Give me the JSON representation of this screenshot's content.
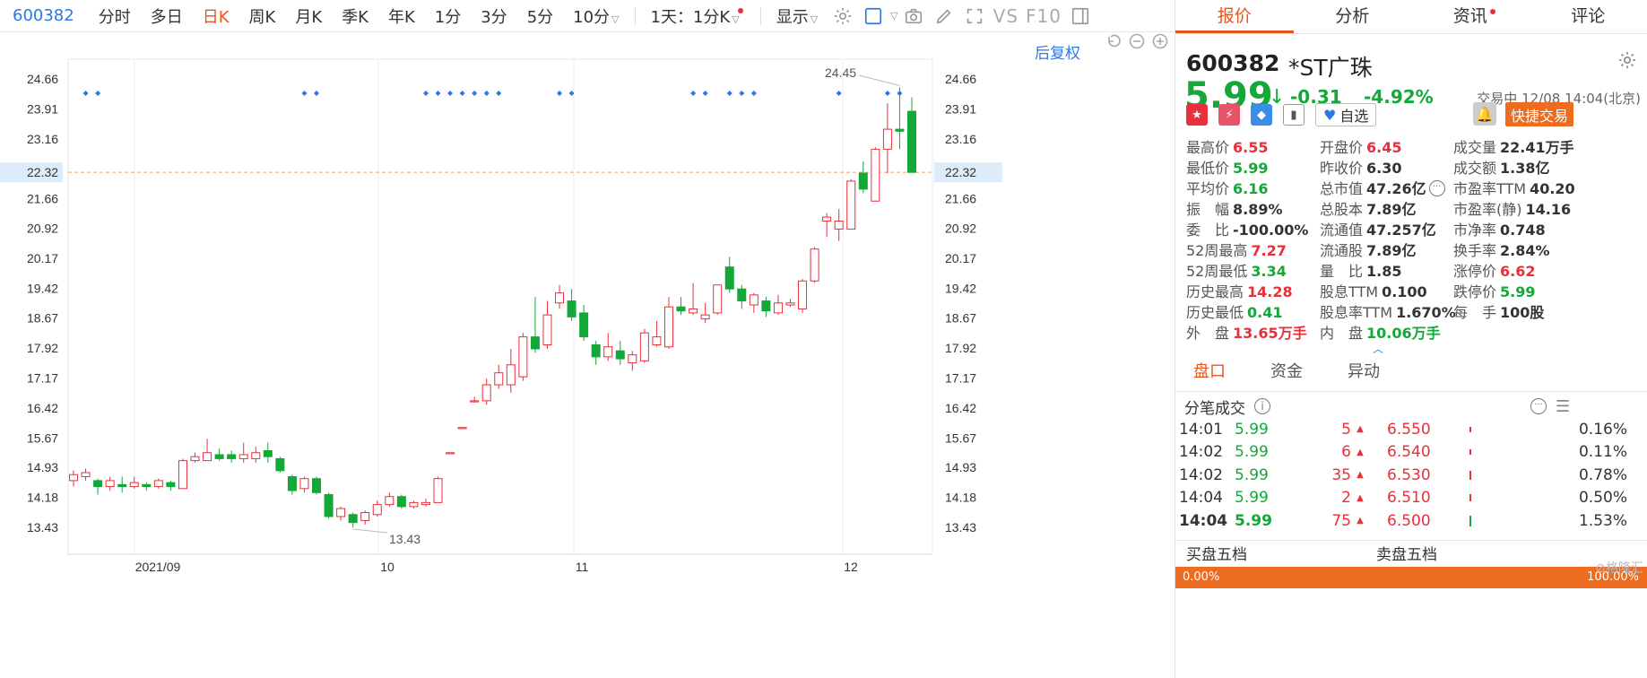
{
  "toolbar": {
    "code": "600382",
    "tabs": [
      "分时",
      "多日",
      "日K",
      "周K",
      "月K",
      "季K",
      "年K",
      "1分",
      "3分",
      "5分",
      "10分"
    ],
    "active_tab": "日K",
    "period_select": "1天：1分K",
    "display_select": "显示"
  },
  "chart": {
    "fq_label": "后复权",
    "price_ticks": [
      "24.66",
      "23.91",
      "23.16",
      "22.32",
      "21.66",
      "20.92",
      "20.17",
      "19.42",
      "18.67",
      "17.92",
      "17.17",
      "16.42",
      "15.67",
      "14.93",
      "14.18",
      "13.43"
    ],
    "crosshair_value": "22.32",
    "max_label": "24.45",
    "min_label": "13.43",
    "date_ticks": [
      "2021/09",
      "10",
      "11",
      "12"
    ]
  },
  "chart_data": {
    "type": "candlestick",
    "ylim": [
      13.0,
      24.9
    ],
    "candles": [
      {
        "o": 14.6,
        "c": 14.75,
        "h": 14.85,
        "l": 14.45
      },
      {
        "o": 14.7,
        "c": 14.8,
        "h": 14.9,
        "l": 14.6
      },
      {
        "o": 14.6,
        "c": 14.45,
        "h": 14.65,
        "l": 14.25
      },
      {
        "o": 14.45,
        "c": 14.6,
        "h": 14.7,
        "l": 14.35
      },
      {
        "o": 14.5,
        "c": 14.45,
        "h": 14.7,
        "l": 14.3
      },
      {
        "o": 14.45,
        "c": 14.55,
        "h": 14.7,
        "l": 14.4
      },
      {
        "o": 14.5,
        "c": 14.45,
        "h": 14.55,
        "l": 14.35
      },
      {
        "o": 14.45,
        "c": 14.6,
        "h": 14.65,
        "l": 14.4
      },
      {
        "o": 14.55,
        "c": 14.45,
        "h": 14.6,
        "l": 14.35
      },
      {
        "o": 14.4,
        "c": 15.1,
        "h": 15.15,
        "l": 14.4
      },
      {
        "o": 15.1,
        "c": 15.2,
        "h": 15.3,
        "l": 15.05
      },
      {
        "o": 15.1,
        "c": 15.3,
        "h": 15.65,
        "l": 15.1
      },
      {
        "o": 15.25,
        "c": 15.15,
        "h": 15.4,
        "l": 15.1
      },
      {
        "o": 15.25,
        "c": 15.15,
        "h": 15.35,
        "l": 15.05
      },
      {
        "o": 15.15,
        "c": 15.25,
        "h": 15.55,
        "l": 15.05
      },
      {
        "o": 15.15,
        "c": 15.3,
        "h": 15.45,
        "l": 15.05
      },
      {
        "o": 15.35,
        "c": 15.2,
        "h": 15.55,
        "l": 15.05
      },
      {
        "o": 15.15,
        "c": 14.85,
        "h": 15.2,
        "l": 14.8
      },
      {
        "o": 14.7,
        "c": 14.35,
        "h": 14.75,
        "l": 14.25
      },
      {
        "o": 14.4,
        "c": 14.65,
        "h": 14.7,
        "l": 14.3
      },
      {
        "o": 14.65,
        "c": 14.3,
        "h": 14.7,
        "l": 14.25
      },
      {
        "o": 14.25,
        "c": 13.7,
        "h": 14.3,
        "l": 13.65
      },
      {
        "o": 13.7,
        "c": 13.9,
        "h": 13.95,
        "l": 13.6
      },
      {
        "o": 13.75,
        "c": 13.55,
        "h": 13.8,
        "l": 13.43
      },
      {
        "o": 13.6,
        "c": 13.8,
        "h": 13.85,
        "l": 13.5
      },
      {
        "o": 13.75,
        "c": 14.0,
        "h": 14.1,
        "l": 13.7
      },
      {
        "o": 14.0,
        "c": 14.2,
        "h": 14.3,
        "l": 13.95
      },
      {
        "o": 14.2,
        "c": 13.95,
        "h": 14.25,
        "l": 13.9
      },
      {
        "o": 13.95,
        "c": 14.05,
        "h": 14.1,
        "l": 13.9
      },
      {
        "o": 14.0,
        "c": 14.05,
        "h": 14.15,
        "l": 13.95
      },
      {
        "o": 14.05,
        "c": 14.65,
        "h": 14.7,
        "l": 14.05
      },
      {
        "o": 15.3,
        "c": 15.3,
        "h": 15.3,
        "l": 15.3
      },
      {
        "o": 15.93,
        "c": 15.93,
        "h": 15.93,
        "l": 15.93
      },
      {
        "o": 16.6,
        "c": 16.6,
        "h": 16.7,
        "l": 16.55
      },
      {
        "o": 16.6,
        "c": 17.0,
        "h": 17.15,
        "l": 16.5
      },
      {
        "o": 17.0,
        "c": 17.3,
        "h": 17.5,
        "l": 16.9
      },
      {
        "o": 17.0,
        "c": 17.5,
        "h": 17.9,
        "l": 16.8
      },
      {
        "o": 17.2,
        "c": 18.2,
        "h": 18.3,
        "l": 17.1
      },
      {
        "o": 18.2,
        "c": 17.9,
        "h": 19.2,
        "l": 17.8
      },
      {
        "o": 18.0,
        "c": 18.75,
        "h": 19.1,
        "l": 17.9
      },
      {
        "o": 19.05,
        "c": 19.3,
        "h": 19.5,
        "l": 18.9
      },
      {
        "o": 19.1,
        "c": 18.7,
        "h": 19.4,
        "l": 18.6
      },
      {
        "o": 18.8,
        "c": 18.2,
        "h": 19.0,
        "l": 18.1
      },
      {
        "o": 18.0,
        "c": 17.7,
        "h": 18.1,
        "l": 17.5
      },
      {
        "o": 17.7,
        "c": 17.95,
        "h": 18.3,
        "l": 17.6
      },
      {
        "o": 17.85,
        "c": 17.65,
        "h": 18.1,
        "l": 17.5
      },
      {
        "o": 17.55,
        "c": 17.75,
        "h": 17.85,
        "l": 17.35
      },
      {
        "o": 17.6,
        "c": 18.3,
        "h": 18.4,
        "l": 17.55
      },
      {
        "o": 18.0,
        "c": 18.2,
        "h": 18.6,
        "l": 17.95
      },
      {
        "o": 17.95,
        "c": 18.95,
        "h": 19.2,
        "l": 17.9
      },
      {
        "o": 18.95,
        "c": 18.85,
        "h": 19.2,
        "l": 18.75
      },
      {
        "o": 18.8,
        "c": 18.9,
        "h": 19.55,
        "l": 18.75
      },
      {
        "o": 18.65,
        "c": 18.75,
        "h": 19.05,
        "l": 18.55
      },
      {
        "o": 18.8,
        "c": 19.5,
        "h": 19.5,
        "l": 18.75
      },
      {
        "o": 19.95,
        "c": 19.4,
        "h": 20.2,
        "l": 19.3
      },
      {
        "o": 19.4,
        "c": 19.1,
        "h": 19.5,
        "l": 18.9
      },
      {
        "o": 19.0,
        "c": 19.25,
        "h": 19.3,
        "l": 18.8
      },
      {
        "o": 19.1,
        "c": 18.85,
        "h": 19.2,
        "l": 18.7
      },
      {
        "o": 18.8,
        "c": 19.05,
        "h": 19.25,
        "l": 18.75
      },
      {
        "o": 19.0,
        "c": 19.05,
        "h": 19.15,
        "l": 18.95
      },
      {
        "o": 18.9,
        "c": 19.6,
        "h": 19.65,
        "l": 18.8
      },
      {
        "o": 19.6,
        "c": 20.4,
        "h": 20.45,
        "l": 19.55
      },
      {
        "o": 21.1,
        "c": 21.2,
        "h": 21.3,
        "l": 20.7
      },
      {
        "o": 20.9,
        "c": 21.1,
        "h": 21.4,
        "l": 20.6
      },
      {
        "o": 20.9,
        "c": 22.1,
        "h": 22.15,
        "l": 20.9
      },
      {
        "o": 22.3,
        "c": 21.9,
        "h": 22.6,
        "l": 21.8
      },
      {
        "o": 21.6,
        "c": 22.9,
        "h": 22.95,
        "l": 21.6
      },
      {
        "o": 22.9,
        "c": 23.4,
        "h": 24.05,
        "l": 22.3
      },
      {
        "o": 23.4,
        "c": 23.35,
        "h": 24.45,
        "l": 22.9
      },
      {
        "o": 23.85,
        "c": 22.32,
        "h": 24.2,
        "l": 22.32
      }
    ],
    "markers_at": [
      1,
      2,
      19,
      20,
      29,
      30,
      31,
      32,
      33,
      34,
      35,
      40,
      41,
      51,
      52,
      54,
      55,
      56,
      63,
      67,
      68
    ]
  },
  "right": {
    "tabs": [
      "报价",
      "分析",
      "资讯",
      "评论"
    ],
    "active_tab": "报价",
    "code": "600382",
    "name": "*ST广珠",
    "price": "5.99",
    "arrow": "↓",
    "change": "-0.31",
    "change_pct": "-4.92%",
    "status": "交易中 12/08 14:04(北京)",
    "zixuan": "自选",
    "fast_trade": "快捷交易",
    "quote": [
      [
        {
          "l": "最高价",
          "v": "6.55",
          "c": "red"
        },
        {
          "l": "开盘价",
          "v": "6.45",
          "c": "red"
        },
        {
          "l": "成交量",
          "v": "22.41万手",
          "c": ""
        }
      ],
      [
        {
          "l": "最低价",
          "v": "5.99",
          "c": "green"
        },
        {
          "l": "昨收价",
          "v": "6.30",
          "c": ""
        },
        {
          "l": "成交额",
          "v": "1.38亿",
          "c": ""
        }
      ],
      [
        {
          "l": "平均价",
          "v": "6.16",
          "c": "green"
        },
        {
          "l": "总市值",
          "v": "47.26亿",
          "c": ""
        },
        {
          "l": "市盈率TTM",
          "v": "40.20",
          "c": ""
        }
      ],
      [
        {
          "l": "振　幅",
          "v": "8.89%",
          "c": ""
        },
        {
          "l": "总股本",
          "v": "7.89亿",
          "c": ""
        },
        {
          "l": "市盈率(静)",
          "v": "14.16",
          "c": ""
        }
      ],
      [
        {
          "l": "委　比",
          "v": "-100.00%",
          "c": ""
        },
        {
          "l": "流通值",
          "v": "47.257亿",
          "c": ""
        },
        {
          "l": "市净率",
          "v": "0.748",
          "c": ""
        }
      ],
      [
        {
          "l": "52周最高",
          "v": "7.27",
          "c": "red"
        },
        {
          "l": "流通股",
          "v": "7.89亿",
          "c": ""
        },
        {
          "l": "换手率",
          "v": "2.84%",
          "c": ""
        }
      ],
      [
        {
          "l": "52周最低",
          "v": "3.34",
          "c": "green"
        },
        {
          "l": "量　比",
          "v": "1.85",
          "c": ""
        },
        {
          "l": "涨停价",
          "v": "6.62",
          "c": "red"
        }
      ],
      [
        {
          "l": "历史最高",
          "v": "14.28",
          "c": "red"
        },
        {
          "l": "股息TTM",
          "v": "0.100",
          "c": ""
        },
        {
          "l": "跌停价",
          "v": "5.99",
          "c": "green"
        }
      ],
      [
        {
          "l": "历史最低",
          "v": "0.41",
          "c": "green"
        },
        {
          "l": "股息率TTM",
          "v": "1.670%",
          "c": ""
        },
        {
          "l": "每　手",
          "v": "100股",
          "c": ""
        }
      ],
      [
        {
          "l": "外　盘",
          "v": "13.65万手",
          "c": "red"
        },
        {
          "l": "内　盘",
          "v": "10.06万手",
          "c": "green"
        }
      ]
    ],
    "subtabs": [
      "盘口",
      "资金",
      "异动"
    ],
    "active_subtab": "盘口",
    "trades_title": "分笔成交",
    "trades": [
      {
        "t": "14:01",
        "p": "5.99",
        "v": "5",
        "bp": "6.550",
        "pct": "0.16%"
      },
      {
        "t": "14:02",
        "p": "5.99",
        "v": "6",
        "bp": "6.540",
        "pct": "0.11%"
      },
      {
        "t": "14:02",
        "p": "5.99",
        "v": "35",
        "bp": "6.530",
        "pct": "0.78%"
      },
      {
        "t": "14:04",
        "p": "5.99",
        "v": "2",
        "bp": "6.510",
        "pct": "0.50%"
      },
      {
        "t": "14:04",
        "p": "5.99",
        "v": "75",
        "bp": "6.500",
        "pct": "1.53%"
      }
    ],
    "buy_five": "买盘五档",
    "sell_five": "卖盘五档",
    "bar_left": "0.00%",
    "bar_right": "100.00%",
    "watermark": "格隆汇"
  }
}
